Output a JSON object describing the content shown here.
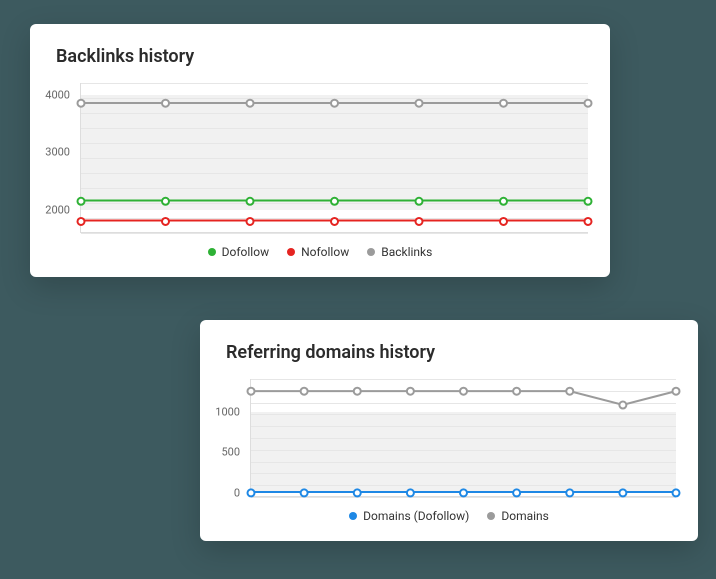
{
  "chart_data": [
    {
      "id": "backlinks",
      "type": "line",
      "title": "Backlinks history",
      "ylabel": "",
      "xlabel": "",
      "y_ticks": [
        2000,
        3000,
        4000
      ],
      "ylim": [
        1600,
        4200
      ],
      "x_count": 7,
      "series": [
        {
          "name": "Dofollow",
          "color": "#2eb135",
          "values": [
            2150,
            2150,
            2150,
            2150,
            2150,
            2150,
            2150
          ]
        },
        {
          "name": "Nofollow",
          "color": "#e52421",
          "values": [
            1800,
            1800,
            1800,
            1800,
            1800,
            1800,
            1800
          ]
        },
        {
          "name": "Backlinks",
          "color": "#9b9b9b",
          "values": [
            3850,
            3850,
            3850,
            3850,
            3850,
            3850,
            3850
          ]
        }
      ],
      "legend": [
        {
          "label": "Dofollow",
          "color": "#2eb135"
        },
        {
          "label": "Nofollow",
          "color": "#e52421"
        },
        {
          "label": "Backlinks",
          "color": "#9b9b9b"
        }
      ]
    },
    {
      "id": "domains",
      "type": "line",
      "title": "Referring domains history",
      "ylabel": "",
      "xlabel": "",
      "y_ticks": [
        0,
        500,
        1000
      ],
      "ylim": [
        -50,
        1400
      ],
      "x_count": 9,
      "series": [
        {
          "name": "Domains (Dofollow)",
          "color": "#1e88e5",
          "values": [
            0,
            0,
            0,
            0,
            0,
            0,
            0,
            0,
            0
          ]
        },
        {
          "name": "Domains",
          "color": "#9b9b9b",
          "values": [
            1250,
            1250,
            1250,
            1250,
            1250,
            1250,
            1250,
            1080,
            1250
          ]
        }
      ],
      "legend": [
        {
          "label": "Domains (Dofollow)",
          "color": "#1e88e5"
        },
        {
          "label": "Domains",
          "color": "#9b9b9b"
        }
      ]
    }
  ],
  "cards": {
    "backlinks": {
      "title": "Backlinks history"
    },
    "domains": {
      "title": "Referring domains history"
    }
  }
}
